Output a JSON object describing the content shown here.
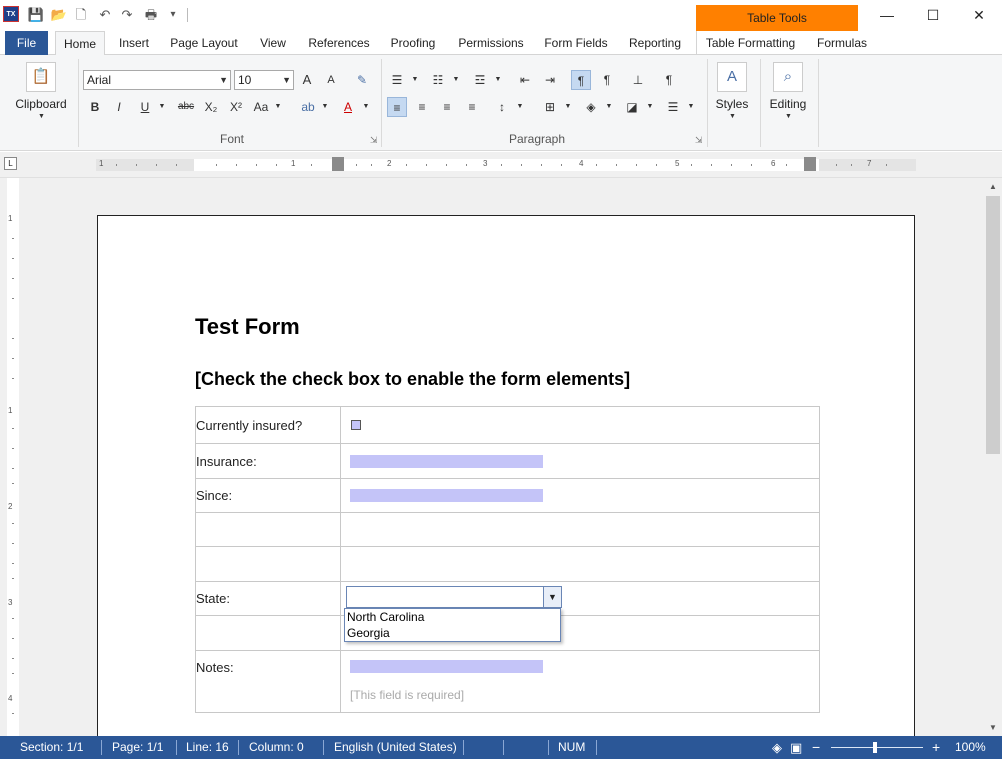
{
  "quick_access": {
    "app_icon_text": "TX",
    "items": [
      {
        "name": "save-icon",
        "glyph": "💾"
      },
      {
        "name": "open-folder-icon",
        "glyph": "📂"
      },
      {
        "name": "new-document-icon",
        "glyph": "🗋"
      },
      {
        "name": "undo-icon",
        "glyph": "↶"
      },
      {
        "name": "redo-icon",
        "glyph": "↷"
      },
      {
        "name": "print-icon",
        "glyph": "🖶"
      },
      {
        "name": "customize-dropdown-icon",
        "glyph": "▾"
      }
    ]
  },
  "contextual_header": "Table Tools",
  "window_controls": {
    "minimize": "—",
    "maximize": "☐",
    "close": "✕"
  },
  "tabs": [
    "File",
    "Home",
    "Insert",
    "Page Layout",
    "View",
    "References",
    "Proofing",
    "Permissions",
    "Form Fields",
    "Reporting",
    "Table Formatting",
    "Formulas"
  ],
  "ribbon": {
    "clipboard": {
      "label": "Clipboard"
    },
    "font": {
      "group_label": "Font",
      "font_name": "Arial",
      "font_size": "10",
      "grow_label": "A",
      "shrink_label": "A",
      "bold": "B",
      "italic": "I",
      "underline": "U",
      "strike": "abc",
      "subscript": "X₂",
      "superscript": "X²",
      "change_case": "Aa"
    },
    "paragraph": {
      "group_label": "Paragraph"
    },
    "styles": {
      "label": "Styles"
    },
    "editing": {
      "label": "Editing"
    }
  },
  "document": {
    "title": "Test Form",
    "subtitle": "[Check the check box to enable the form elements]",
    "rows": [
      {
        "label": "Currently insured?"
      },
      {
        "label": "Insurance:"
      },
      {
        "label": "Since:"
      },
      {
        "label": ""
      },
      {
        "label": ""
      },
      {
        "label": "State:"
      },
      {
        "label": ""
      },
      {
        "label": "Notes:"
      }
    ],
    "state_options": [
      "North Carolina",
      "Georgia"
    ],
    "notes_hint": "[This field is required]"
  },
  "status_bar": {
    "section": "Section: 1/1",
    "page": "Page: 1/1",
    "line": "Line: 16",
    "column": "Column: 0",
    "language": "English (United States)",
    "num": "NUM",
    "zoom": "100%",
    "zoom_minus": "−",
    "zoom_plus": "+"
  },
  "colors": {
    "accent": "#2b5797",
    "context_tab": "#ff8000",
    "form_field": "#c4c4f8"
  }
}
